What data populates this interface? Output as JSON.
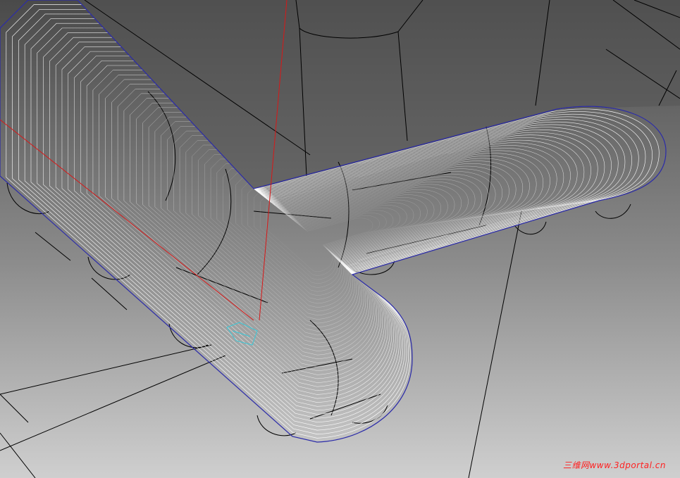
{
  "viewport": {
    "background_top": "#4c4c4c",
    "background_bottom": "#c8c8c8",
    "toolpath_color": "#ffffff",
    "boundary_color": "#2a2aa8",
    "tool_axis_color": "#d81818",
    "tool_marker_color": "#38c8d8",
    "edge_color": "#000000"
  },
  "watermark": {
    "text": "三维网www.3dportal.cn",
    "color": "#ff2020"
  }
}
